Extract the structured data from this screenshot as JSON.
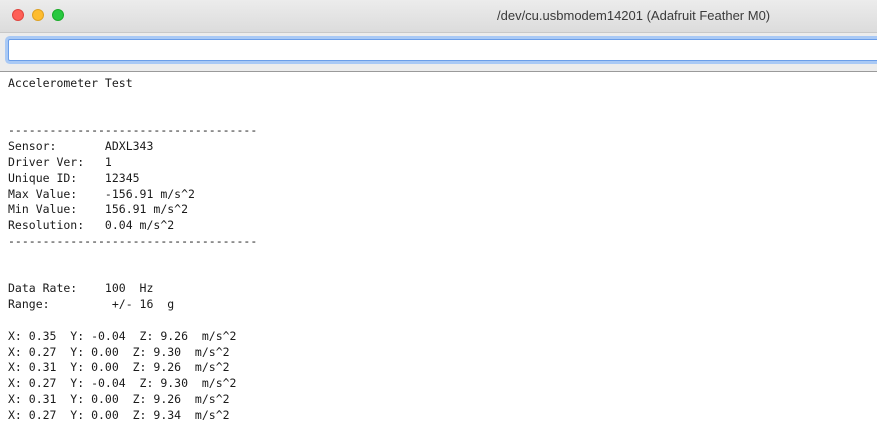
{
  "window": {
    "title": "/dev/cu.usbmodem14201 (Adafruit Feather M0)"
  },
  "input": {
    "value": "",
    "placeholder": ""
  },
  "output_lines": [
    "Accelerometer Test",
    "",
    "",
    "------------------------------------",
    "Sensor:       ADXL343",
    "Driver Ver:   1",
    "Unique ID:    12345",
    "Max Value:    -156.91 m/s^2",
    "Min Value:    156.91 m/s^2",
    "Resolution:   0.04 m/s^2",
    "------------------------------------",
    "",
    "",
    "Data Rate:    100  Hz",
    "Range:         +/- 16  g",
    "",
    "X: 0.35  Y: -0.04  Z: 9.26  m/s^2",
    "X: 0.27  Y: 0.00  Z: 9.30  m/s^2",
    "X: 0.31  Y: 0.00  Z: 9.26  m/s^2",
    "X: 0.27  Y: -0.04  Z: 9.30  m/s^2",
    "X: 0.31  Y: 0.00  Z: 9.26  m/s^2",
    "X: 0.27  Y: 0.00  Z: 9.34  m/s^2"
  ]
}
